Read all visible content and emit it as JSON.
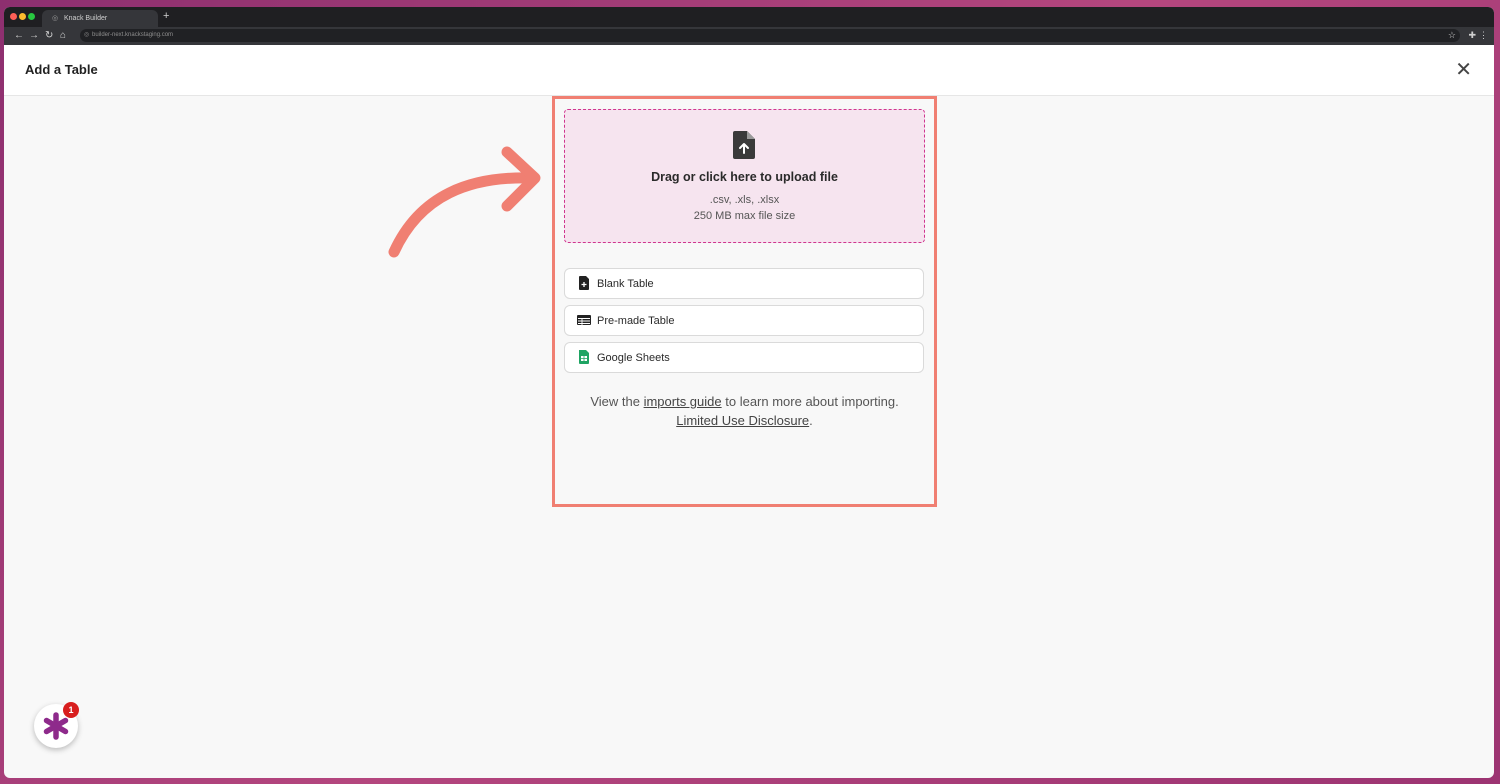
{
  "browser": {
    "tab_title": "Knack Builder",
    "url": "builder-next.knackstaging.com"
  },
  "modal": {
    "title": "Add a Table",
    "close_icon": "close-icon"
  },
  "upload": {
    "title": "Drag or click here to upload file",
    "file_types": ".csv, .xls, .xlsx",
    "max_size": "250 MB max file size",
    "icon": "file-upload-icon"
  },
  "options": [
    {
      "label": "Blank Table",
      "icon": "file-plus-icon"
    },
    {
      "label": "Pre-made Table",
      "icon": "table-icon"
    },
    {
      "label": "Google Sheets",
      "icon": "google-sheets-icon"
    }
  ],
  "help": {
    "prefix": "View the",
    "link_text": "imports guide",
    "suffix": "to learn more about importing.",
    "disclosure_link": "Limited Use Disclosure",
    "period": "."
  },
  "chat_widget": {
    "badge_count": "1",
    "icon": "asterisk-icon"
  },
  "colors": {
    "highlight": "#f07f72",
    "dropzone_bg": "#f6e4ef",
    "dropzone_border": "#d0358f",
    "brand": "#8e2a8b"
  }
}
